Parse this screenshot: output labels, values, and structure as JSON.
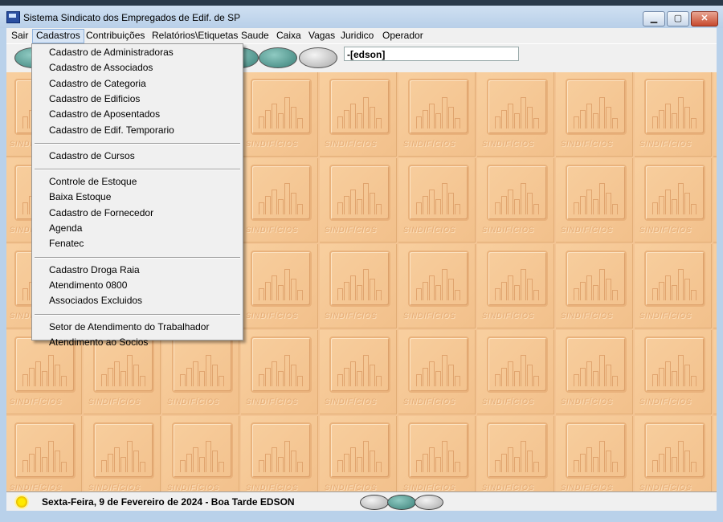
{
  "window": {
    "title": "Sistema Sindicato dos Empregados de Edif. de SP",
    "min_glyph": "▁",
    "max_glyph": "▢",
    "close_glyph": "✕"
  },
  "menu": {
    "items": [
      "Sair",
      "Cadastros",
      "Contribuições",
      "Relatórios\\Etiquetas",
      "Saude",
      "Caixa",
      "Vagas",
      "Juridico",
      "Operador"
    ],
    "active": "Cadastros"
  },
  "toolbar": {
    "user_field": "-[edson]"
  },
  "dropdown": {
    "groups": [
      [
        "Cadastro de Administradoras",
        "Cadastro de Associados",
        "Cadastro de Categoria",
        "Cadastro de Edificios",
        "Cadastro de Aposentados",
        "Cadastro de Edif. Temporario"
      ],
      [
        "Cadastro de Cursos"
      ],
      [
        "Controle de Estoque",
        "Baixa Estoque",
        "Cadastro de Fornecedor",
        "Agenda",
        "Fenatec"
      ],
      [
        "Cadastro Droga Raia",
        "Atendimento 0800",
        "Associados Excluidos"
      ],
      [
        "Setor de Atendimento do Trabalhador",
        "Atendimento ao Socios"
      ]
    ]
  },
  "background": {
    "tile_word": "SINDIFÍCIOS"
  },
  "status": {
    "text": "Sexta-Feira,  9 de Fevereiro de 2024 - Boa Tarde  EDSON",
    "icon": "sun-icon"
  },
  "colors": {
    "workspace": "#f3c493",
    "title_bar": "#b9d1ea",
    "close_button": "#c74a2e",
    "teal_button": "#3a8078"
  }
}
